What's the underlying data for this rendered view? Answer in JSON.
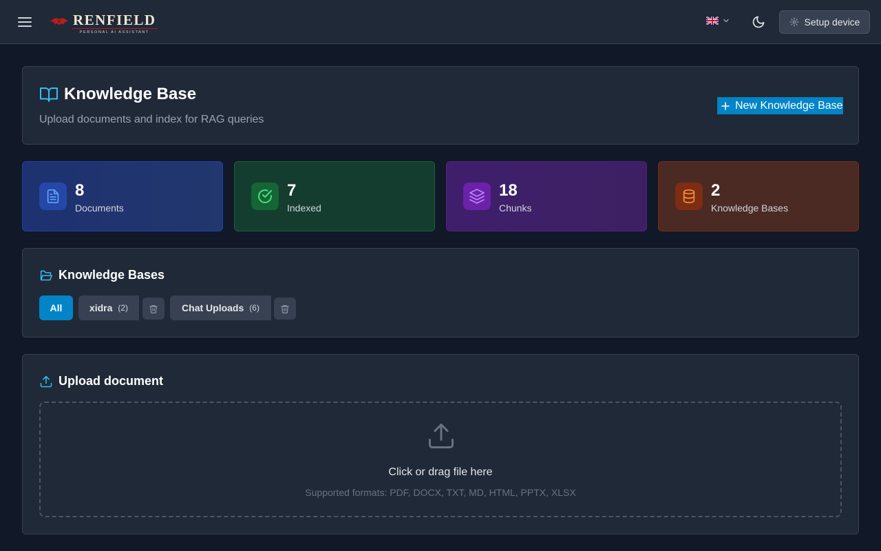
{
  "header": {
    "logo_name": "RENFIELD",
    "logo_tagline": "PERSONAL AI ASSISTANT",
    "setup_label": "Setup device"
  },
  "hero": {
    "title": "Knowledge Base",
    "subtitle": "Upload documents and index for RAG queries",
    "new_button": "New Knowledge Base"
  },
  "stats": [
    {
      "value": "8",
      "label": "Documents"
    },
    {
      "value": "7",
      "label": "Indexed"
    },
    {
      "value": "18",
      "label": "Chunks"
    },
    {
      "value": "2",
      "label": "Knowledge Bases"
    }
  ],
  "knowledge_bases": {
    "title": "Knowledge Bases",
    "all_label": "All",
    "items": [
      {
        "name": "xidra",
        "count": "(2)"
      },
      {
        "name": "Chat Uploads",
        "count": "(6)"
      }
    ]
  },
  "upload": {
    "title": "Upload document",
    "prompt": "Click or drag file here",
    "formats": "Supported formats: PDF, DOCX, TXT, MD, HTML, PPTX, XLSX"
  },
  "colors": {
    "accent": "#0284c7",
    "background": "#111827",
    "card": "#1f2937"
  }
}
